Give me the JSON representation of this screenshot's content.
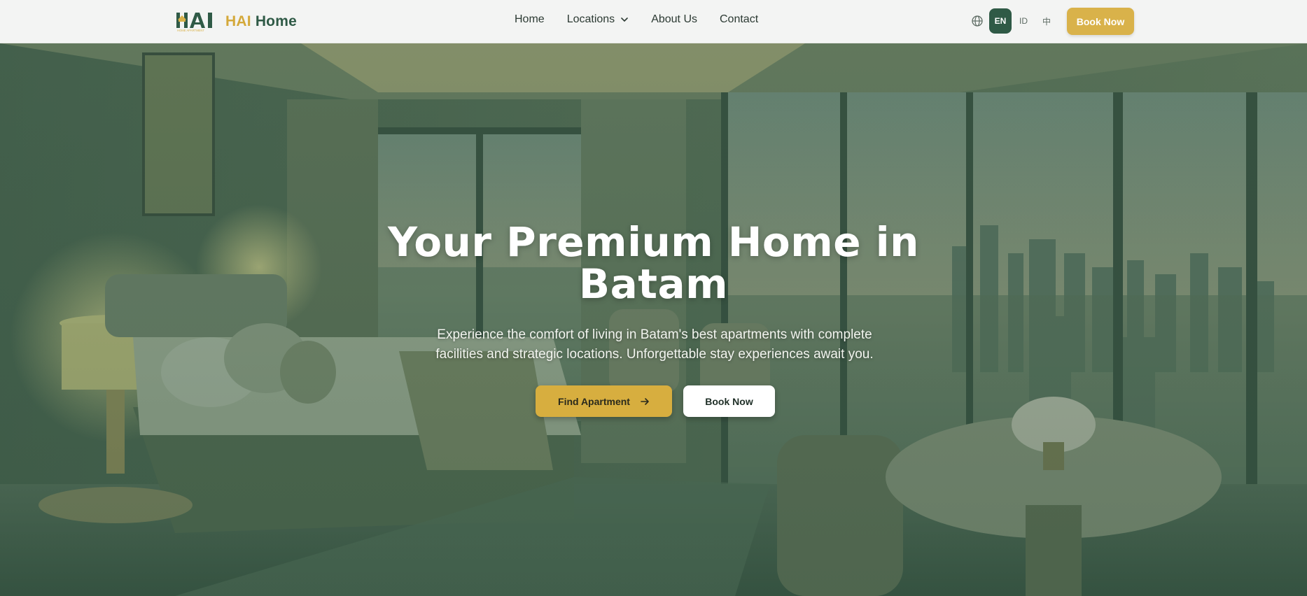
{
  "brand": {
    "logo_mark_text": "HAI",
    "logo_mark_subtext": "HOME APARTMENT",
    "name_part1": "HAI",
    "name_part2": "Home"
  },
  "nav": {
    "items": [
      {
        "label": "Home"
      },
      {
        "label": "Locations",
        "has_dropdown": true
      },
      {
        "label": "About Us"
      },
      {
        "label": "Contact"
      }
    ]
  },
  "language": {
    "options": [
      "EN",
      "ID",
      "中"
    ],
    "selected": "EN"
  },
  "header": {
    "book_label": "Book Now"
  },
  "hero": {
    "title_line1": "Your Premium Home in",
    "title_line2": "Batam",
    "subtitle": "Experience the comfort of living in Batam's best apartments with complete facilities and strategic locations. Unforgettable stay experiences await you.",
    "primary_cta": "Find Apartment",
    "secondary_cta": "Book Now"
  },
  "colors": {
    "brand_green": "#2f5a46",
    "brand_gold": "#d9b24a",
    "overlay_green": "#284838"
  }
}
